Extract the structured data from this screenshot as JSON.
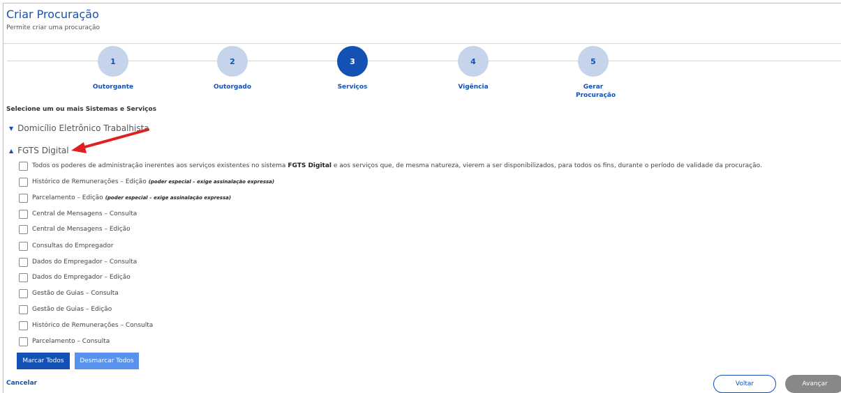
{
  "header": {
    "title": "Criar Procuração",
    "subtitle": "Permite criar uma procuração"
  },
  "steps": [
    {
      "number": "1",
      "label": "Outorgante",
      "active": false
    },
    {
      "number": "2",
      "label": "Outorgado",
      "active": false
    },
    {
      "number": "3",
      "label": "Serviços",
      "active": true
    },
    {
      "number": "4",
      "label": "Vigência",
      "active": false
    },
    {
      "number": "5",
      "label": "Gerar Procuração",
      "active": false
    }
  ],
  "section_label": "Selecione um ou mais Sistemas e Serviços",
  "groups": {
    "domicilio": {
      "label": "Domicílio Eletrônico Trabalhista",
      "expanded": false,
      "icon": "chevron-down-icon"
    },
    "fgts": {
      "label": "FGTS Digital",
      "expanded": true,
      "icon": "chevron-up-icon"
    }
  },
  "services": {
    "all_powers": {
      "pre": "Todos os poderes de administração inerentes aos serviços existentes no sistema",
      "bold": "FGTS Digital",
      "post": "e aos serviços que, de mesma natureza, vierem a ser disponibilizados, para todos os fins, durante o período de validade da procuração."
    },
    "items": [
      {
        "label": "Histórico de Remunerações – Edição",
        "note": "(poder especial – exige assinalação expressa)"
      },
      {
        "label": "Parcelamento – Edição",
        "note": "(poder especial – exige assinalação expressa)"
      },
      {
        "label": "Central de Mensagens – Consulta",
        "note": ""
      },
      {
        "label": "Central de Mensagens – Edição",
        "note": ""
      },
      {
        "label": "Consultas do Empregador",
        "note": ""
      },
      {
        "label": "Dados do Empregador – Consulta",
        "note": ""
      },
      {
        "label": "Dados do Empregador – Edição",
        "note": ""
      },
      {
        "label": "Gestão de Guias – Consulta",
        "note": ""
      },
      {
        "label": "Gestão de Guias – Edição",
        "note": ""
      },
      {
        "label": "Histórico de Remunerações – Consulta",
        "note": ""
      },
      {
        "label": "Parcelamento – Consulta",
        "note": ""
      }
    ]
  },
  "buttons": {
    "select_all": "Marcar Todos",
    "deselect_all": "Desmarcar Todos",
    "cancel": "Cancelar",
    "back": "Voltar",
    "next": "Avançar"
  },
  "colors": {
    "primary": "#1351b4",
    "secondary": "#5992ed",
    "annotation_arrow": "#e02020",
    "disabled": "#888888"
  }
}
